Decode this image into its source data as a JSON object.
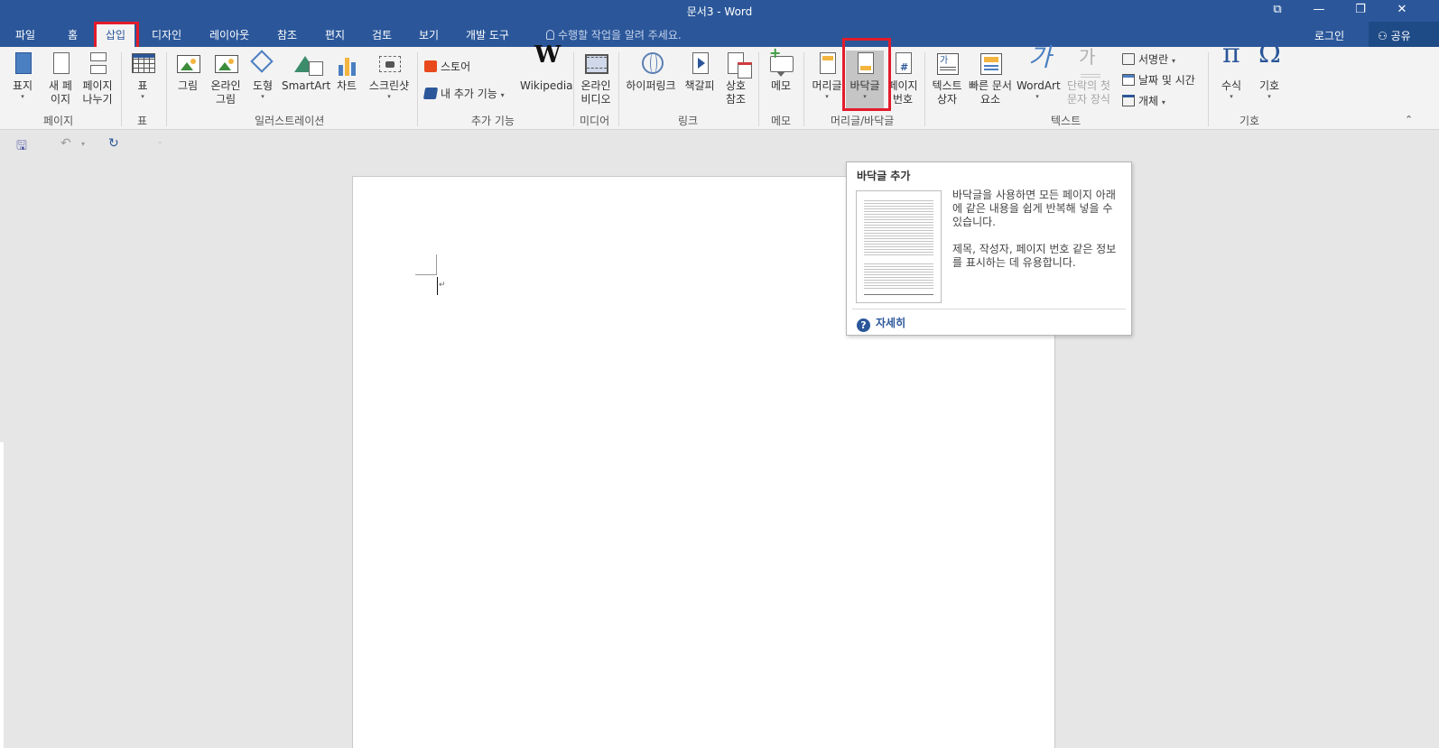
{
  "app": {
    "title": "문서3 - Word",
    "window_buttons": [
      "⧉",
      "—",
      "❐",
      "✕"
    ]
  },
  "tabs": [
    {
      "label": "파일"
    },
    {
      "label": "홈"
    },
    {
      "label": "삽입"
    },
    {
      "label": "디자인"
    },
    {
      "label": "레이아웃"
    },
    {
      "label": "참조"
    },
    {
      "label": "편지"
    },
    {
      "label": "검토"
    },
    {
      "label": "보기"
    },
    {
      "label": "개발 도구"
    }
  ],
  "active_tab": "삽입",
  "tell_me": "수행할 작업을 알려 주세요.",
  "login": "로그인",
  "share": "공유",
  "ribbon": {
    "pages": {
      "group": "페이지",
      "cover": "표지",
      "new_page_1": "새 페",
      "new_page_2": "이지",
      "break_1": "페이지",
      "break_2": "나누기"
    },
    "tables": {
      "group": "표",
      "table": "표"
    },
    "illustrations": {
      "group": "일러스트레이션",
      "picture": "그림",
      "online_1": "온라인",
      "online_2": "그림",
      "shapes": "도형",
      "smartart": "SmartArt",
      "chart": "차트",
      "screenshot": "스크린샷"
    },
    "addins": {
      "group": "추가 기능",
      "store": "스토어",
      "my_addins": "내 추가 기능",
      "wikipedia": "Wikipedia"
    },
    "media": {
      "group": "미디어",
      "video_1": "온라인",
      "video_2": "비디오"
    },
    "links": {
      "group": "링크",
      "hyperlink": "하이퍼링크",
      "bookmark": "책갈피",
      "xref_1": "상호",
      "xref_2": "참조"
    },
    "comments": {
      "group": "메모",
      "comment": "메모"
    },
    "header_footer": {
      "group": "머리글/바닥글",
      "header": "머리글",
      "footer": "바닥글",
      "page_number_1": "페이지",
      "page_number_2": "번호"
    },
    "text": {
      "group": "텍스트",
      "textbox_1": "텍스트",
      "textbox_2": "상자",
      "quickparts_1": "빠른 문서",
      "quickparts_2": "요소",
      "wordart": "WordArt",
      "dropcap_1": "단락의 첫",
      "dropcap_2": "문자 장식",
      "signature": "서명란",
      "datetime": "날짜 및 시간",
      "object": "개체"
    },
    "symbols": {
      "group": "기호",
      "equation": "수식",
      "symbol": "기호"
    }
  },
  "tooltip": {
    "title": "바닥글 추가",
    "desc1": "바닥글을 사용하면 모든 페이지 아래에 같은 내용을 쉽게 반복해 넣을 수 있습니다.",
    "desc2": "제목, 작성자, 페이지 번호 같은 정보를 표시하는 데 유용합니다.",
    "more": "자세히"
  },
  "document": {
    "paragraph_mark": "↵"
  },
  "colors": {
    "accent": "#2b579a",
    "highlight": "#e31c2b"
  }
}
